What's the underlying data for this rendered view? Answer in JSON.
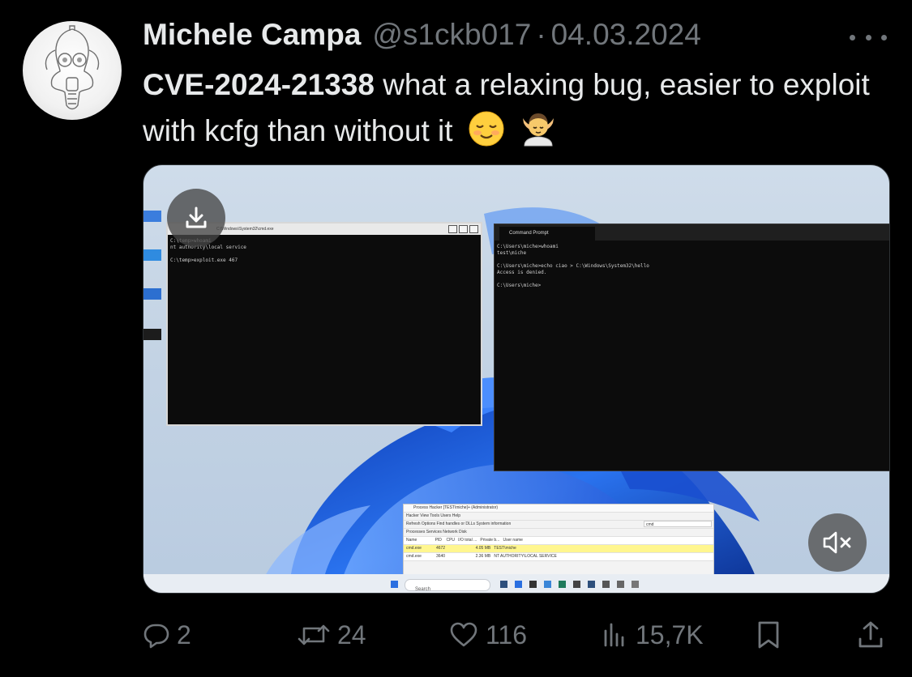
{
  "author": {
    "name": "Michele Campa",
    "handle": "@s1ckb017",
    "separator": "·",
    "date": "04.03.2024"
  },
  "tweet": {
    "cve": "CVE-2024-21338",
    "text": " what a relaxing bug, easier to exploit with kcfg than without it",
    "emojis": [
      "relieved-face-emoji",
      "person-getting-massage-emoji"
    ]
  },
  "media": {
    "terminal_left": {
      "title": "C:\\Windows\\System32\\cmd.exe",
      "lines": "C:\\temp>whoami\nnt authority\\local service\n\nC:\\temp>exploit.exe 467"
    },
    "terminal_right": {
      "tab_title": "Command Prompt",
      "lines": "C:\\Users\\miche>whoami\ntest\\miche\n\nC:\\Users\\miche>echo ciao > C:\\Windows\\System32\\hello\nAccess is denied.\n\nC:\\Users\\miche>"
    },
    "process_hacker": {
      "title": "Process Hacker [TEST\\miche]+ (Administrator)",
      "menu": "Hacker   View   Tools   Users   Help",
      "toolbar": "Refresh   Options   Find handles or DLLs   System information",
      "filter": "cmd",
      "tabs": "Processes   Services   Network   Disk",
      "columns": "Name                PID    CPU   I/O total ...   Private b...   User name",
      "rows": [
        "cmd.exe             4672                           4.05 MB   TEST\\miche",
        "cmd.exe             3640                           2.36 MB   NT AUTHORITY\\LOCAL SERVICE"
      ]
    },
    "taskbar_search": "Search",
    "buttons": {
      "download": "download-icon",
      "mute": "muted-speaker-icon"
    }
  },
  "actions": {
    "replies": "2",
    "reposts": "24",
    "likes": "116",
    "views": "15,7K"
  },
  "colors": {
    "background": "#000000",
    "primary_text": "#e7e9ea",
    "secondary_text": "#71767b",
    "windows_blue": "#1f5fd6"
  }
}
